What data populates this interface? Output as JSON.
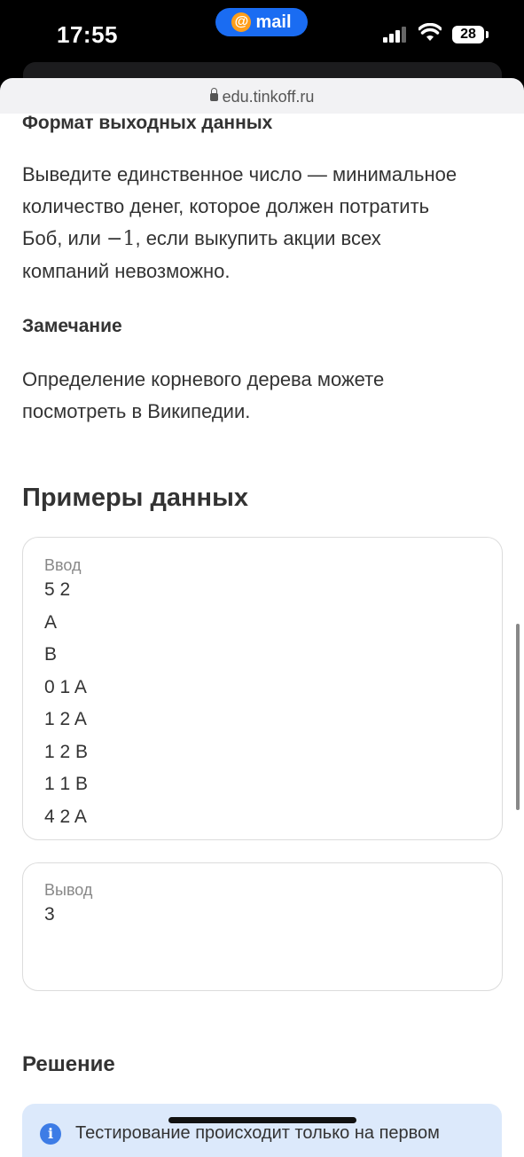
{
  "status": {
    "time": "17:55",
    "mail_label": "mail",
    "at_symbol": "@",
    "battery": "28"
  },
  "browser": {
    "url": "edu.tinkoff.ru"
  },
  "output_format": {
    "heading": "Формат выходных данных",
    "line1": "Выведите единственное число — минимальное",
    "line2": "количество денег, которое должен потратить",
    "line3_a": "Боб, или ",
    "line3_math": "−1",
    "line3_b": ", если выкупить акции всех",
    "line4": "компаний невозможно."
  },
  "note": {
    "heading": "Замечание",
    "line1": "Определение корневого дерева можете",
    "line2": "посмотреть в Википедии."
  },
  "examples": {
    "heading": "Примеры данных",
    "input_label": "Ввод",
    "input_lines": [
      "5 2",
      "A",
      "B",
      "0 1 A",
      "1 2 A",
      "1 2 B",
      "1 1 B",
      "4 2 A"
    ],
    "output_label": "Вывод",
    "output_lines": [
      "3"
    ]
  },
  "solution": {
    "heading": "Решение",
    "info_text": "Тестирование происходит только на первом"
  }
}
